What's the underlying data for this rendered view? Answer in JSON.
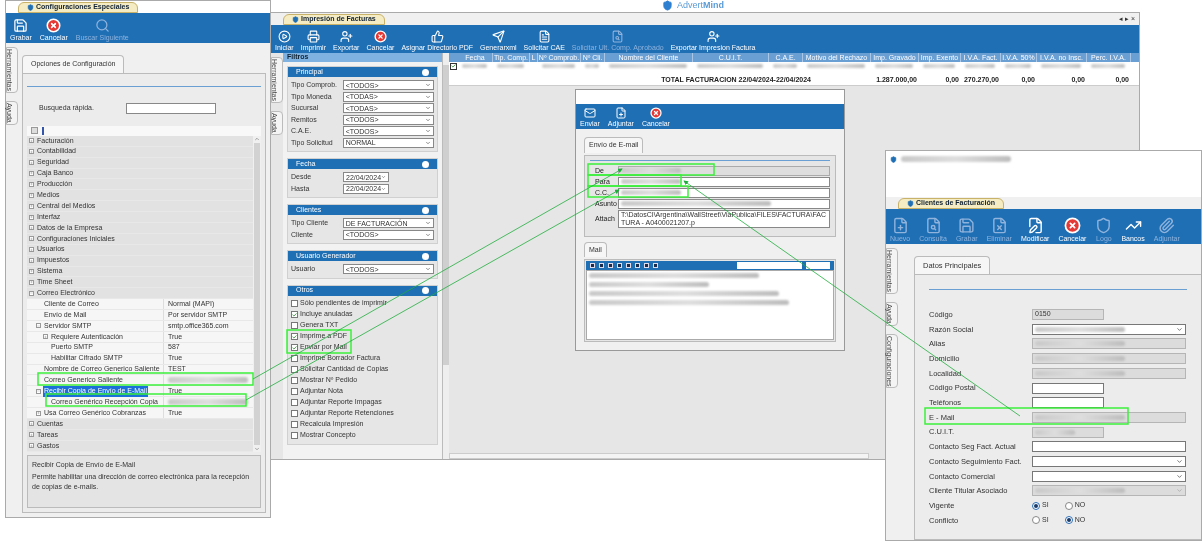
{
  "logo": {
    "text": "Advert**Mind**"
  },
  "config_window": {
    "tab": "Configuraciones Especiales",
    "toolbar": [
      {
        "label": "Grabar",
        "disabled": false
      },
      {
        "label": "Cancelar",
        "disabled": false
      },
      {
        "label": "Buscar Siguiente",
        "disabled": true
      }
    ],
    "side_tabs": [
      "Herramientas",
      "Ayuda"
    ],
    "panel_tab": "Opciones de Configuración",
    "search_label": "Busqueda rápida.",
    "tree": [
      {
        "label": "Facturación",
        "expanded": false,
        "selected": false
      },
      {
        "label": "Contabilidad",
        "expanded": false,
        "selected": false
      },
      {
        "label": "Seguridad",
        "expanded": false,
        "selected": false
      },
      {
        "label": "Caja Banco",
        "expanded": false,
        "selected": false
      },
      {
        "label": "Producción",
        "expanded": false,
        "selected": false
      },
      {
        "label": "Medios",
        "expanded": false,
        "selected": false
      },
      {
        "label": "Central del Medios",
        "expanded": false,
        "selected": false
      },
      {
        "label": "Interfaz",
        "expanded": false,
        "selected": false
      },
      {
        "label": "Datos de la Empresa",
        "expanded": false,
        "selected": false
      },
      {
        "label": "Configuraciones Iniciales",
        "expanded": false,
        "selected": false
      },
      {
        "label": "Usuarios",
        "expanded": false,
        "selected": false
      },
      {
        "label": "Impuestos",
        "expanded": false,
        "selected": false
      },
      {
        "label": "Sistema",
        "expanded": false,
        "selected": false
      },
      {
        "label": "Time Sheet",
        "expanded": false,
        "selected": false
      },
      {
        "label": "Correo Electrónico",
        "expanded": true,
        "selected": false,
        "children": [
          {
            "label": "Cliente de Correo",
            "value": "Normal (MAPI)",
            "selected": false
          },
          {
            "label": "Envío de Mail",
            "value": "Por servidor SMTP",
            "selected": false
          },
          {
            "label": "Servidor SMTP",
            "value": "smtp.office365.com",
            "expanded": true,
            "selected": false,
            "children": [
              {
                "label": "Requiere Autenticación",
                "value": "True",
                "expanded": false,
                "selected": false
              },
              {
                "label": "Puerto SMTP",
                "value": "587",
                "selected": false
              },
              {
                "label": "Habilitar Cifrado SMTP",
                "value": "True",
                "selected": false
              }
            ]
          },
          {
            "label": "Nombre de Correo Generico Saliente",
            "value": "TEST",
            "selected": false
          },
          {
            "label": "Correo Generico Saliente",
            "value_blurred": true,
            "selected": false
          },
          {
            "label": "Recibir Copia de Envío de E-Mail",
            "value": "True",
            "expanded": true,
            "selected": true,
            "children": [
              {
                "label": "Correo Genérico Recepción Copia",
                "value_blurred": true,
                "selected": false
              }
            ]
          },
          {
            "label": "Usa Correo Genérico Cobranzas",
            "value": "True",
            "expanded": false,
            "selected": false
          }
        ]
      },
      {
        "label": "Cuentas",
        "expanded": false,
        "selected": false
      },
      {
        "label": "Tareas",
        "expanded": false,
        "selected": false
      },
      {
        "label": "Gastos",
        "expanded": false,
        "selected": false
      }
    ],
    "description": {
      "title": "Recibir Copia de Envío de E-Mail",
      "text": "Permite habilitar una dirección de correo electrónica para la recepción de copias de e-mails."
    }
  },
  "invoice_window": {
    "tab": "Impresión de Facturas",
    "window_controls": "◂ ▸ ×",
    "toolbar": [
      {
        "label": "Iniciar",
        "disabled": false
      },
      {
        "label": "Imprimir",
        "disabled": false
      },
      {
        "label": "Exportar",
        "disabled": false
      },
      {
        "label": "Cancelar",
        "disabled": false
      },
      {
        "label": "Asignar Directorio PDF",
        "disabled": false
      },
      {
        "label": "Generarxml",
        "disabled": false
      },
      {
        "label": "Solicitar CAE",
        "disabled": false
      },
      {
        "label": "Solicitar Ult. Comp. Aprobado",
        "disabled": true
      },
      {
        "label": "Exportar Impresion Factura",
        "disabled": false
      }
    ],
    "side_tabs": [
      "Herramientas",
      "Ayuda"
    ],
    "filters_title": "Filtros",
    "filter_groups": [
      {
        "title": "Principal",
        "fields": [
          {
            "label": "Tipo Comprob.",
            "value": "<TODOS>"
          },
          {
            "label": "Tipo Moneda",
            "value": "<TODAS>"
          },
          {
            "label": "Sucursal",
            "value": "<TODAS>"
          },
          {
            "label": "Remitos",
            "value": "<TODOS>"
          },
          {
            "label": "C.A.E.",
            "value": "<TODOS>"
          },
          {
            "label": "Tipo Solicitud",
            "value": "NORMAL"
          }
        ]
      },
      {
        "title": "Fecha",
        "fields": [
          {
            "label": "Desde",
            "value": "22/04/2024",
            "kind": "date"
          },
          {
            "label": "Hasta",
            "value": "22/04/2024",
            "kind": "date"
          }
        ]
      },
      {
        "title": "Clientes",
        "fields": [
          {
            "label": "Tipo Cliente",
            "value": "DE FACTURACIÓN"
          },
          {
            "label": "Cliente",
            "value": "<TODOS>"
          }
        ]
      },
      {
        "title": "Usuario Generador",
        "fields": [
          {
            "label": "Usuario",
            "value": "<TODOS>"
          }
        ]
      },
      {
        "title": "Otros",
        "checkboxes": [
          {
            "label": "Sólo pendientes de imprimir",
            "checked": false
          },
          {
            "label": "Incluye anuladas",
            "checked": true
          },
          {
            "label": "Genera TXT",
            "checked": false
          },
          {
            "label": "Imprime a PDF",
            "checked": true
          },
          {
            "label": "Enviar por Mail",
            "checked": true
          },
          {
            "label": "Imprime Borrador Factura",
            "checked": false
          },
          {
            "label": "Solicitar Cantidad de Copias",
            "checked": false
          },
          {
            "label": "Mostrar Nº Pedido",
            "checked": false
          },
          {
            "label": "Adjuntar Nota",
            "checked": false
          },
          {
            "label": "Adjuntar Reporte Impagas",
            "checked": false
          },
          {
            "label": "Adjuntar Reporte Retenciones",
            "checked": false
          },
          {
            "label": "Recalcula Impresión",
            "checked": false
          },
          {
            "label": "Mostrar Concepto",
            "checked": false
          }
        ]
      }
    ],
    "grid": {
      "columns": [
        "Fecha",
        "Tip. Comp.",
        "L",
        "Nº Comprob.",
        "Nº Cli.",
        "Nombre del Cliente",
        "C.U.I.T.",
        "C.A.E.",
        "Motivo del Rechazo",
        "Imp. Gravado",
        "Imp. Exento",
        "I.V.A. Fact.",
        "I.V.A. 50%",
        "I.V.A. no Insc.",
        "Perc. I.V.A."
      ],
      "rows": [
        {
          "checked": true
        }
      ],
      "total_label": "TOTAL FACTURACION 22/04/2024-22/04/2024",
      "totals": [
        "1.287.000,00",
        "0,00",
        "270.270,00",
        "0,00",
        "0,00",
        "0,00"
      ]
    }
  },
  "email_dialog": {
    "toolbar": [
      "Enviar",
      "Adjuntar",
      "Cancelar"
    ],
    "tab": "Envío de E-mail",
    "fields": [
      {
        "label": "De",
        "disabled": true
      },
      {
        "label": "Para",
        "disabled": false
      },
      {
        "label": "C.C.",
        "disabled": false
      },
      {
        "label": "Asunto",
        "disabled": false
      },
      {
        "label": "Attach",
        "disabled": false,
        "value": "T:\\DatosCI\\Argentina\\WallStreet\\ViaPublica\\FILES\\FACTURA\\FACTURA - A0400021207.p"
      }
    ],
    "body_tab": "Mail"
  },
  "client_window": {
    "tab": "Clientes de Facturación",
    "toolbar": [
      {
        "label": "Nuevo",
        "disabled": true
      },
      {
        "label": "Consulta",
        "disabled": true
      },
      {
        "label": "Grabar",
        "disabled": true
      },
      {
        "label": "Eliminar",
        "disabled": true
      },
      {
        "label": "Modificar",
        "disabled": false
      },
      {
        "label": "Cancelar",
        "disabled": false
      },
      {
        "label": "Logo",
        "disabled": true
      },
      {
        "label": "Bancos",
        "disabled": false
      },
      {
        "label": "Adjuntar",
        "disabled": true
      }
    ],
    "side_tabs": [
      "Herramientas",
      "Ayuda",
      "Configuraciones"
    ],
    "panel_tab": "Datos Principales",
    "fields": [
      {
        "label": "Código",
        "kind": "short",
        "value": "0150",
        "disabled": true
      },
      {
        "label": "Razón Social",
        "kind": "select",
        "disabled": false
      },
      {
        "label": "Alias",
        "kind": "text",
        "disabled": true
      },
      {
        "label": "Domicilio",
        "kind": "text",
        "disabled": true
      },
      {
        "label": "Localidad",
        "kind": "text",
        "disabled": true
      },
      {
        "label": "Código Postal",
        "kind": "short",
        "disabled": false
      },
      {
        "label": "Teléfonos",
        "kind": "short",
        "disabled": false
      },
      {
        "label": "E - Mail",
        "kind": "text",
        "disabled": true
      },
      {
        "label": "C.U.I.T.",
        "kind": "short",
        "disabled": true
      },
      {
        "label": "Contacto Seg Fact. Actual",
        "kind": "text",
        "disabled": false
      },
      {
        "label": "Contacto Seguimiento Fact.",
        "kind": "select",
        "disabled": false
      },
      {
        "label": "Contacto Comercial",
        "kind": "select",
        "disabled": false
      },
      {
        "label": "Cliente Titular Asociado",
        "kind": "select",
        "disabled": true
      },
      {
        "label": "Vigente",
        "kind": "radio",
        "options": [
          {
            "label": "SI",
            "selected": true
          },
          {
            "label": "NO",
            "selected": false
          }
        ]
      },
      {
        "label": "Conflicto",
        "kind": "radio",
        "options": [
          {
            "label": "SI",
            "selected": false
          },
          {
            "label": "NO",
            "selected": true
          }
        ]
      }
    ]
  }
}
